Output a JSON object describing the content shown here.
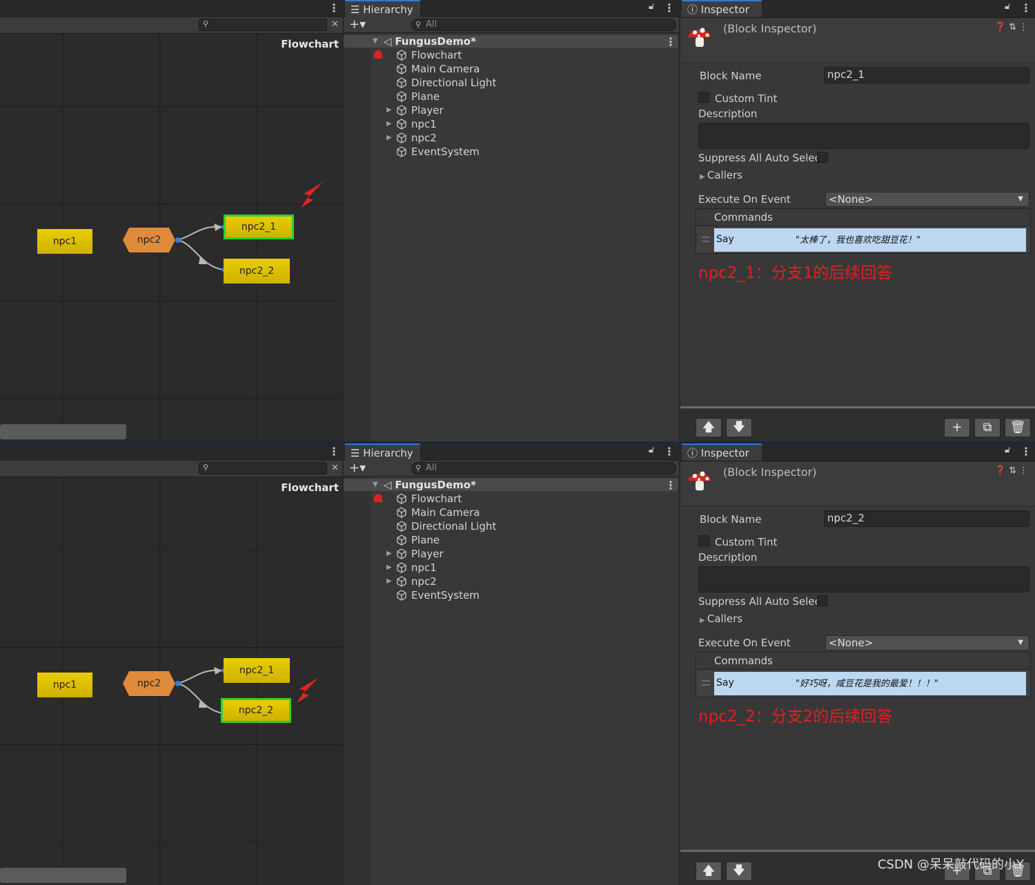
{
  "top": {
    "flowchart": {
      "title": "Flowchart",
      "nodes": {
        "npc1": "npc1",
        "npc2": "npc2",
        "npc2_1": "npc2_1",
        "npc2_2": "npc2_2"
      },
      "selected_node": "npc2_1"
    },
    "hierarchy": {
      "tab": "Hierarchy",
      "search_placeholder": "All",
      "scene": "FungusDemo*",
      "items": [
        "Flowchart",
        "Main Camera",
        "Directional Light",
        "Plane",
        "Player",
        "npc1",
        "npc2",
        "EventSystem"
      ]
    },
    "inspector": {
      "tab": "Inspector",
      "title": "(Block Inspector)",
      "block_name_label": "Block Name",
      "block_name_value": "npc2_1",
      "custom_tint_label": "Custom Tint",
      "description_label": "Description",
      "suppress_label": "Suppress All Auto Selec",
      "callers_label": "Callers",
      "execute_label": "Execute On Event",
      "execute_value": "<None>",
      "commands_label": "Commands",
      "command_name": "Say",
      "command_text": "\"太棒了，我也喜欢吃甜豆花！\"",
      "annotation": "npc2_1：分支1的后续回答"
    }
  },
  "bottom": {
    "flowchart": {
      "title": "Flowchart",
      "nodes": {
        "npc1": "npc1",
        "npc2": "npc2",
        "npc2_1": "npc2_1",
        "npc2_2": "npc2_2"
      },
      "selected_node": "npc2_2"
    },
    "hierarchy": {
      "tab": "Hierarchy",
      "search_placeholder": "All",
      "scene": "FungusDemo*",
      "items": [
        "Flowchart",
        "Main Camera",
        "Directional Light",
        "Plane",
        "Player",
        "npc1",
        "npc2",
        "EventSystem"
      ]
    },
    "inspector": {
      "tab": "Inspector",
      "title": "(Block Inspector)",
      "block_name_label": "Block Name",
      "block_name_value": "npc2_2",
      "custom_tint_label": "Custom Tint",
      "description_label": "Description",
      "suppress_label": "Suppress All Auto Selec",
      "callers_label": "Callers",
      "execute_label": "Execute On Event",
      "execute_value": "<None>",
      "commands_label": "Commands",
      "command_name": "Say",
      "command_text": "\"好巧呀，咸豆花是我的最爱！！！\"",
      "annotation": "npc2_2：分支2的后续回答"
    }
  },
  "watermark": "CSDN @呆呆敲代码的小Y",
  "colors": {
    "node": "#dcc000",
    "branch": "#e08a3c",
    "selected_border": "#2ad32a",
    "annotation": "#e32020",
    "command_row": "#bcd7f0"
  }
}
